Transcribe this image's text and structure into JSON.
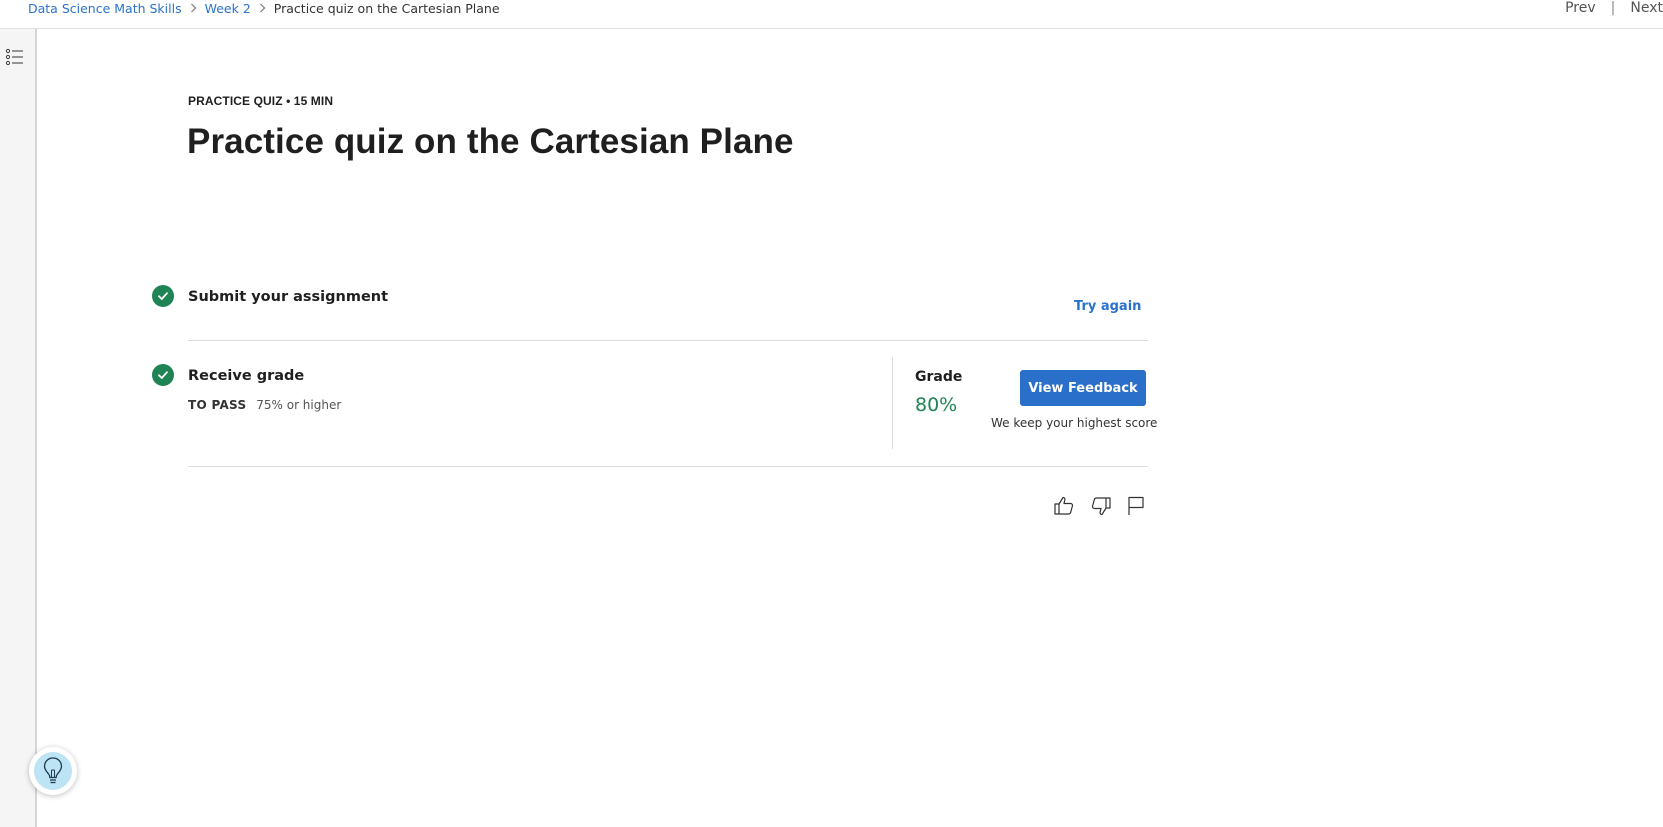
{
  "breadcrumb": {
    "items": [
      "Data Science Math Skills",
      "Week 2"
    ],
    "current": "Practice quiz on the Cartesian Plane"
  },
  "nav": {
    "prev": "Prev",
    "divider": "|",
    "next": "Next"
  },
  "quiz": {
    "kicker": "PRACTICE QUIZ • 15 MIN",
    "title": "Practice quiz on the Cartesian Plane"
  },
  "steps": {
    "submit": {
      "title": "Submit your assignment",
      "action": "Try again"
    },
    "receive": {
      "title": "Receive grade",
      "pass_label": "TO PASS",
      "pass_value": "75% or higher",
      "grade_label": "Grade",
      "grade_value": "80%",
      "button": "View Feedback",
      "note": "We keep your highest score"
    }
  },
  "icons": {
    "toc": "list-icon",
    "like": "thumbs-up-icon",
    "dislike": "thumbs-down-icon",
    "flag": "flag-icon",
    "help": "lightbulb-icon"
  },
  "colors": {
    "link": "#2a73cc",
    "success": "#1f8354",
    "primary_button": "#2a6fca"
  }
}
